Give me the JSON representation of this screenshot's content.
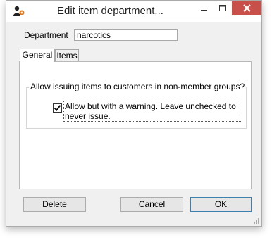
{
  "window": {
    "title": "Edit item department...",
    "controls": {
      "minimize": "minimize-icon",
      "maximize": "maximize-icon",
      "close": "close-icon"
    },
    "close_color": "#c7504a"
  },
  "form": {
    "department_label": "Department",
    "department_value": "narcotics"
  },
  "tabs": [
    {
      "label": "General",
      "selected": true
    },
    {
      "label": "Items",
      "selected": false
    }
  ],
  "general": {
    "group_title": "Allow issuing items to customers in non-member groups?",
    "checkbox_label": "Allow but with a warning. Leave unchecked to never issue.",
    "checkbox_checked": true
  },
  "buttons": {
    "delete": "Delete",
    "cancel": "Cancel",
    "ok": "OK"
  },
  "colors": {
    "focus_border": "#3c7fb1",
    "dialog_bg": "#f0f0f0"
  }
}
